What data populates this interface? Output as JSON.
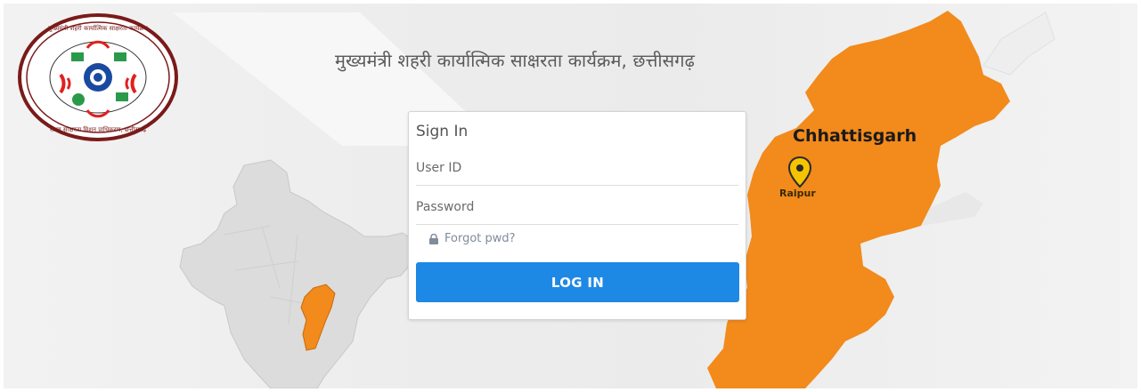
{
  "header": {
    "title": "मुख्यमंत्री शहरी कार्यात्मिक साक्षरता कार्यक्रम, छत्तीसगढ़"
  },
  "map": {
    "state_label": "Chhattisgarh",
    "city_label": "Raipur",
    "state_color": "#f28a1c",
    "india_color": "#dcdcdc"
  },
  "logo": {
    "top_text": "मुख्यमंत्री शहरी कार्यात्मिक साक्षरता कार्यक्रम",
    "bottom_text": "राज्य साक्षरता मिशन प्राधिकरण, छत्तीसगढ़",
    "ring_color": "#7a1a1a"
  },
  "signin": {
    "heading": "Sign In",
    "userid_placeholder": "User ID",
    "password_placeholder": "Password",
    "forgot_label": "Forgot pwd?",
    "login_label": "LOG IN",
    "button_color": "#1e88e5"
  },
  "icons": {
    "forgot": "lock-icon",
    "city_marker": "map-pin-icon"
  }
}
